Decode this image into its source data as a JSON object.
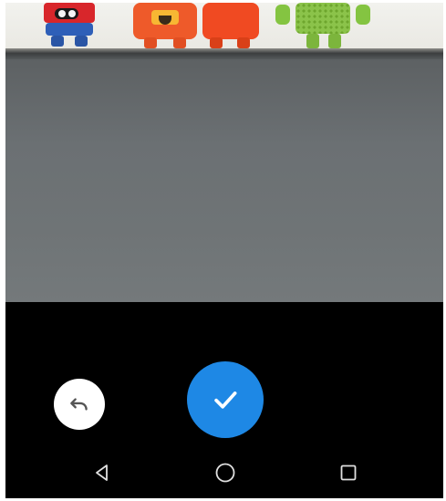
{
  "screen": {
    "name": "camera-photo-review"
  },
  "preview": {
    "description_icon": "camera-preview-image"
  },
  "controls": {
    "undo_icon": "undo-icon",
    "confirm_icon": "checkmark-icon",
    "confirm_color": "#1e88e5",
    "undo_bg_color": "#ffffff"
  },
  "navbar": {
    "back_icon": "nav-back-triangle-icon",
    "home_icon": "nav-home-circle-icon",
    "recents_icon": "nav-recents-square-icon"
  }
}
